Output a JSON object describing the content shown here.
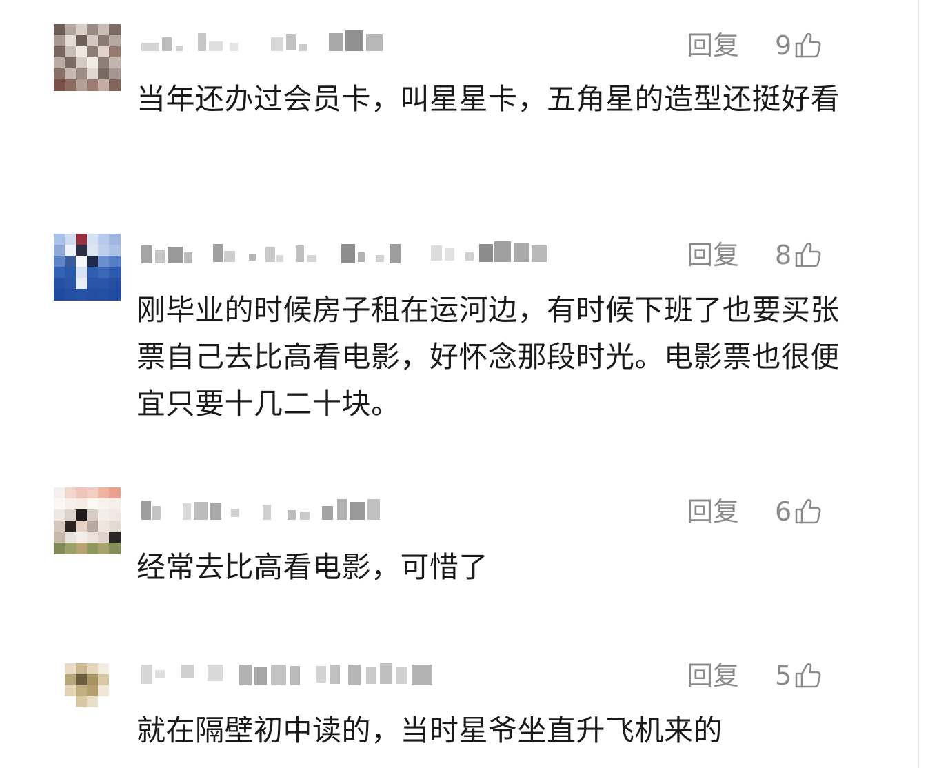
{
  "comments": [
    {
      "username": "",
      "reply_label": "回复",
      "likes": "9",
      "text": "当年还办过会员卡，叫星星卡，五角星的造型还挺好看"
    },
    {
      "username": "",
      "reply_label": "回复",
      "likes": "8",
      "text": "刚毕业的时候房子租在运河边，有时候下班了也要买张票自己去比高看电影，好怀念那段时光。电影票也很便宜只要十几二十块。"
    },
    {
      "username": "",
      "reply_label": "回复",
      "likes": "6",
      "text": "经常去比高看电影，可惜了"
    },
    {
      "username": "",
      "reply_label": "回复",
      "likes": "5",
      "text": "就在隔壁初中读的，当时星爷坐直升飞机来的"
    }
  ],
  "icons": {
    "like": "thumbs-up-icon",
    "avatar": "avatar-pixelated"
  },
  "colors": {
    "meta_gray": "#8a8a8a",
    "text": "#1a1a1a",
    "background": "#ffffff"
  }
}
